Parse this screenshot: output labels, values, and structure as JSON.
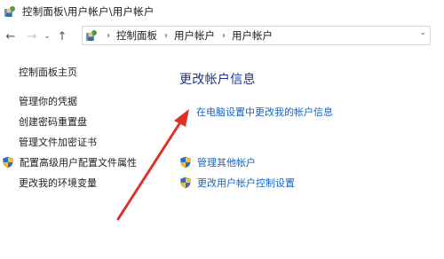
{
  "window": {
    "title": "控制面板\\用户帐户\\用户帐户"
  },
  "nav": {
    "back_icon": "back-arrow-icon",
    "forward_icon": "forward-arrow-icon",
    "recent_icon": "chevron-down-icon",
    "up_icon": "up-arrow-icon",
    "breadcrumbs": [
      "控制面板",
      "用户帐户",
      "用户帐户"
    ]
  },
  "sidebar": {
    "home": "控制面板主页",
    "items": [
      "管理你的凭据",
      "创建密码重置盘",
      "管理文件加密证书",
      "配置高级用户配置文件属性",
      "更改我的环境变量"
    ]
  },
  "main": {
    "heading": "更改帐户信息",
    "settings_link": "在电脑设置中更改我的帐户信息",
    "manage_other": "管理其他帐户",
    "uac_settings": "更改用户帐户控制设置"
  },
  "colors": {
    "heading": "#1e3287",
    "link": "#1565c0",
    "annotation_arrow": "#e0302a"
  }
}
